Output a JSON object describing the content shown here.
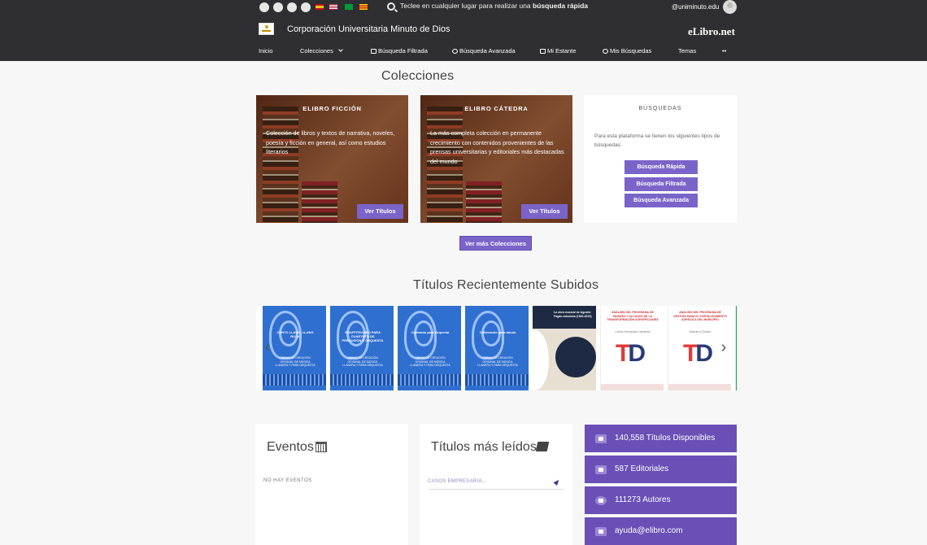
{
  "topbar": {
    "search_hint_prefix": "Teclee en cualquier lugar para realizar una ",
    "search_hint_strong": "búsqueda rápida",
    "user_email": "@uniminuto.edu",
    "institution": "Corporación Universitaria Minuto de Dios",
    "brand": "eLibro.net",
    "utility_icons": [
      "globe-icon",
      "link-icon",
      "zoom-out-icon",
      "zoom-in-icon"
    ],
    "flags": [
      "es-flag",
      "us-flag",
      "br-flag",
      "ca-flag"
    ]
  },
  "nav": {
    "inicio": "Inicio",
    "colecciones": "Colecciones",
    "busqueda_filtrada": "Búsqueda Filtrada",
    "busqueda_avanzada": "Búsqueda Avanzada",
    "mi_estante": "Mi Estante",
    "mis_busquedas": "Mis Búsquedas",
    "temas": "Temas",
    "more": "••"
  },
  "colecciones": {
    "heading": "Colecciones",
    "cards": [
      {
        "title": "ELIBRO FICCIÓN",
        "description": "Colección de libros y textos de narrativa, noveles, poesía y ficción en general, así como estudios literarios",
        "button": "Ver Títulos"
      },
      {
        "title": "ELIBRO CÁTEDRA",
        "description": "La más completa colección en permanente crecimiento con contenidos provenientes de las prensas universitarias y editoriales más destacadas del mundo",
        "button": "Ver Títulos"
      }
    ],
    "more_button": "Ver más Colecciones"
  },
  "busquedas": {
    "title": "BÚSQUEDAS",
    "description": "Para esta plataforma se tienen los siguientes tipos de búsquedas:",
    "buttons": [
      "Búsqueda Rápida",
      "Búsqueda Filtrada",
      "Búsqueda Avanzada"
    ]
  },
  "recientes": {
    "heading": "Títulos Recientemente Subidos",
    "prev_arrow": "‹",
    "next_arrow": "›",
    "covers": [
      {
        "style": "blue",
        "title": "CANTO LLANO, LLANO ROCK",
        "subtitle": "OBRAS DE CREACIÓN ORIGINAL DE MÚSICA LLANERA Y PARA ORQUESTA"
      },
      {
        "style": "blue",
        "title": "GRAFFITEANDO PARA CUARTETO DE PERCUSIÓN Y ORQUESTA",
        "subtitle": "OBRAS DE CREACIÓN ORIGINAL DE MÚSICA LLANERA Y PARA ORQUESTA"
      },
      {
        "style": "blue",
        "title": "Cantando para Orquesta",
        "subtitle": "OBRAS DE CREACIÓN ORIGINAL DE MÚSICA LLANERA Y PARA ORQUESTA"
      },
      {
        "style": "blue",
        "title": "Celebrando para banda",
        "subtitle": "OBRAS DE CREACIÓN ORIGINAL DE MÚSICA LLANERA Y PARA ORQUESTA"
      },
      {
        "style": "pale",
        "title": "La obra musical de Agustín Pagán Arboleda (1930-2010)"
      },
      {
        "style": "white",
        "title": "ANÁLISIS DEL PROGRAMA DE PARAÍSO Y ALCANCE DE LA TRANSFORMACIÓN AGROPECUARIA",
        "author": "Carlos Hernández Jaramillo"
      },
      {
        "style": "white",
        "title": "ANÁLISIS DEL PROGRAMA DE GESTIÓN PARA EL FORTALECIMIENTO AGRÍCOLA DEL MUNICIPIO",
        "author": "Manuel el Duarte"
      }
    ]
  },
  "eventos": {
    "title": "Eventos",
    "empty": "NO HAY EVENTOS"
  },
  "mas_leidos": {
    "title": "Títulos más leídos",
    "item": "CASOS EMPRESARIA..."
  },
  "stats": [
    {
      "icon": "book-icon",
      "text": "140,558 Títulos Disponibles"
    },
    {
      "icon": "bank-icon",
      "text": "587 Editoriales"
    },
    {
      "icon": "user-icon",
      "text": "111273 Autores"
    },
    {
      "icon": "mail-icon",
      "text": "ayuda@elibro.com"
    }
  ],
  "colors": {
    "topbar": "#2f2f33",
    "accent": "#7b64c9",
    "stat_bg": "#6a4fb6",
    "page_bg": "#f7f7f7"
  }
}
